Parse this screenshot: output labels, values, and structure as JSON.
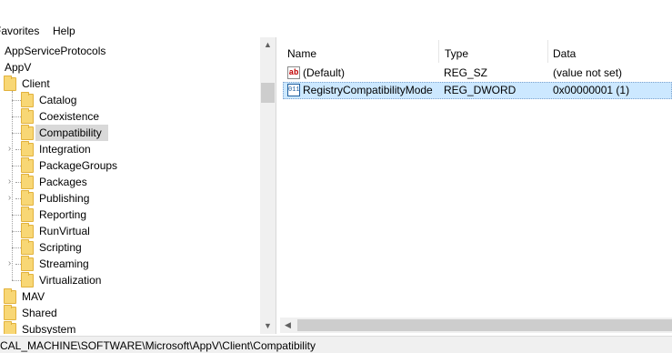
{
  "menubar": {
    "items": [
      "Favorites",
      "Help"
    ]
  },
  "tree": {
    "nodes": [
      {
        "label": "AppServiceProtocols"
      },
      {
        "label": "AppV"
      },
      {
        "label": "Client"
      },
      {
        "label": "Catalog"
      },
      {
        "label": "Coexistence"
      },
      {
        "label": "Compatibility"
      },
      {
        "label": "Integration"
      },
      {
        "label": "PackageGroups"
      },
      {
        "label": "Packages"
      },
      {
        "label": "Publishing"
      },
      {
        "label": "Reporting"
      },
      {
        "label": "RunVirtual"
      },
      {
        "label": "Scripting"
      },
      {
        "label": "Streaming"
      },
      {
        "label": "Virtualization"
      },
      {
        "label": "MAV"
      },
      {
        "label": "Shared"
      },
      {
        "label": "Subsystem"
      }
    ],
    "selected": "Compatibility",
    "icons": {
      "folder": "folder-icon",
      "expand": "chevron-right-icon"
    }
  },
  "list": {
    "columns": [
      "Name",
      "Type",
      "Data"
    ],
    "rows": [
      {
        "name": "(Default)",
        "type": "REG_SZ",
        "data": "(value not set)",
        "icon": "string-value-icon"
      },
      {
        "name": "RegistryCompatibilityMode",
        "type": "REG_DWORD",
        "data": "0x00000001 (1)",
        "icon": "binary-value-icon"
      }
    ],
    "selected_row": "RegistryCompatibilityMode"
  },
  "status": {
    "path": "CAL_MACHINE\\SOFTWARE\\Microsoft\\AppV\\Client\\Compatibility"
  },
  "colors": {
    "selection": "#cce8ff",
    "tree_selection": "#d9d9d9",
    "folder": "#f8d775"
  }
}
